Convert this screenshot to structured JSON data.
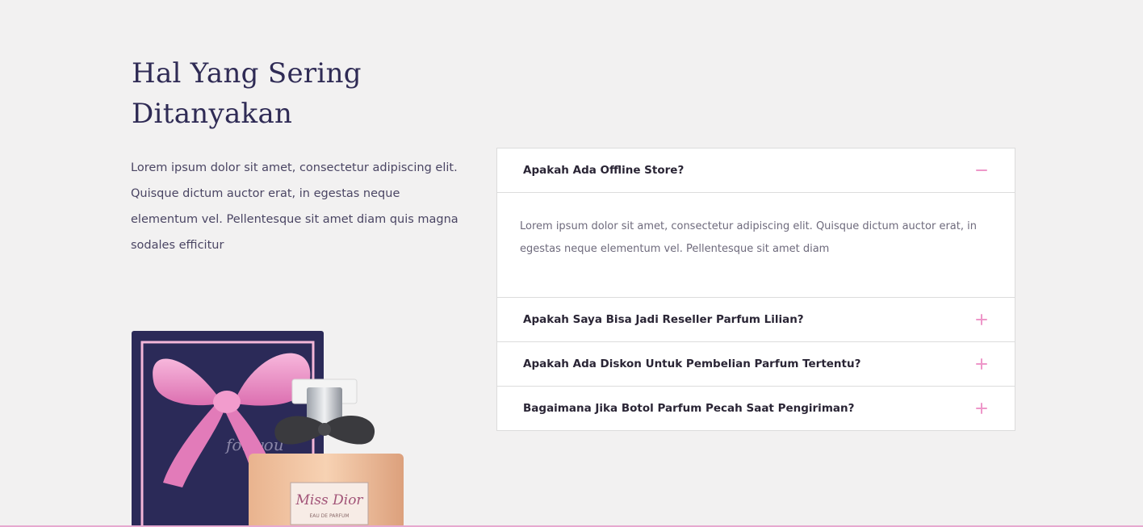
{
  "faq_section": {
    "heading": "Hal Yang Sering Ditanyakan",
    "intro": "Lorem ipsum dolor sit amet, consectetur adipiscing elit. Quisque dictum auctor erat, in egestas neque elementum vel. Pellentesque sit amet diam quis magna sodales efficitur",
    "items": [
      {
        "question": "Apakah Ada Offline Store?",
        "expanded": true,
        "toggle_icon": "minus-icon",
        "answer": "Lorem ipsum dolor sit amet, consectetur adipiscing elit. Quisque dictum auctor erat, in egestas neque elementum vel. Pellentesque sit amet diam"
      },
      {
        "question": "Apakah Saya Bisa Jadi Reseller Parfum Lilian?",
        "expanded": false,
        "toggle_icon": "plus-icon"
      },
      {
        "question": "Apakah Ada Diskon Untuk Pembelian Parfum Tertentu?",
        "expanded": false,
        "toggle_icon": "plus-icon"
      },
      {
        "question": "Bagaimana Jika Botol Parfum Pecah Saat Pengiriman?",
        "expanded": false,
        "toggle_icon": "plus-icon"
      }
    ]
  },
  "product_image": {
    "box_label": "for you",
    "bottle_brand": "Miss Dior",
    "bottle_subtitle": "EAU DE PARFUM"
  },
  "colors": {
    "background": "#f2f1f1",
    "heading": "#2f2b55",
    "accent_pink": "#ee97c9",
    "box_navy": "#2b2a58",
    "border": "#dcdcdc"
  }
}
